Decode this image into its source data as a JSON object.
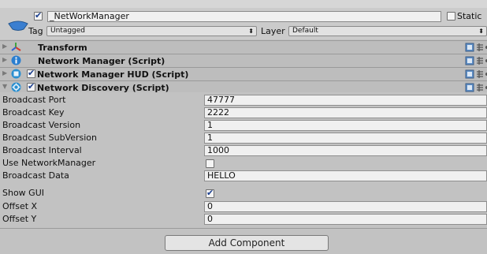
{
  "gameobject": {
    "active": true,
    "name": "_NetWorkManager",
    "static_label": "Static",
    "static_checked": false,
    "tag_label": "Tag",
    "tag_value": "Untagged",
    "layer_label": "Layer",
    "layer_value": "Default"
  },
  "components": [
    {
      "title": "Transform",
      "icon": "transform-icon",
      "expanded": false,
      "has_checkbox": false
    },
    {
      "title": "Network Manager (Script)",
      "icon": "info-icon",
      "expanded": false,
      "has_checkbox": false
    },
    {
      "title": "Network Manager HUD (Script)",
      "icon": "hud-icon",
      "expanded": false,
      "has_checkbox": true,
      "enabled": true
    },
    {
      "title": "Network Discovery (Script)",
      "icon": "gear-script-icon",
      "expanded": true,
      "has_checkbox": true,
      "enabled": true
    }
  ],
  "properties": [
    {
      "label": "Broadcast Port",
      "type": "text",
      "value": "47777"
    },
    {
      "label": "Broadcast Key",
      "type": "text",
      "value": "2222"
    },
    {
      "label": "Broadcast Version",
      "type": "text",
      "value": "1"
    },
    {
      "label": "Broadcast SubVersion",
      "type": "text",
      "value": "1"
    },
    {
      "label": "Broadcast Interval",
      "type": "text",
      "value": "1000"
    },
    {
      "label": "Use NetworkManager",
      "type": "checkbox",
      "checked": false
    },
    {
      "label": "Broadcast Data",
      "type": "text",
      "value": "HELLO"
    },
    {
      "label": "Show GUI",
      "type": "checkbox",
      "checked": true
    },
    {
      "label": "Offset X",
      "type": "text",
      "value": "0"
    },
    {
      "label": "Offset Y",
      "type": "text",
      "value": "0"
    }
  ],
  "add_component_label": "Add Component"
}
